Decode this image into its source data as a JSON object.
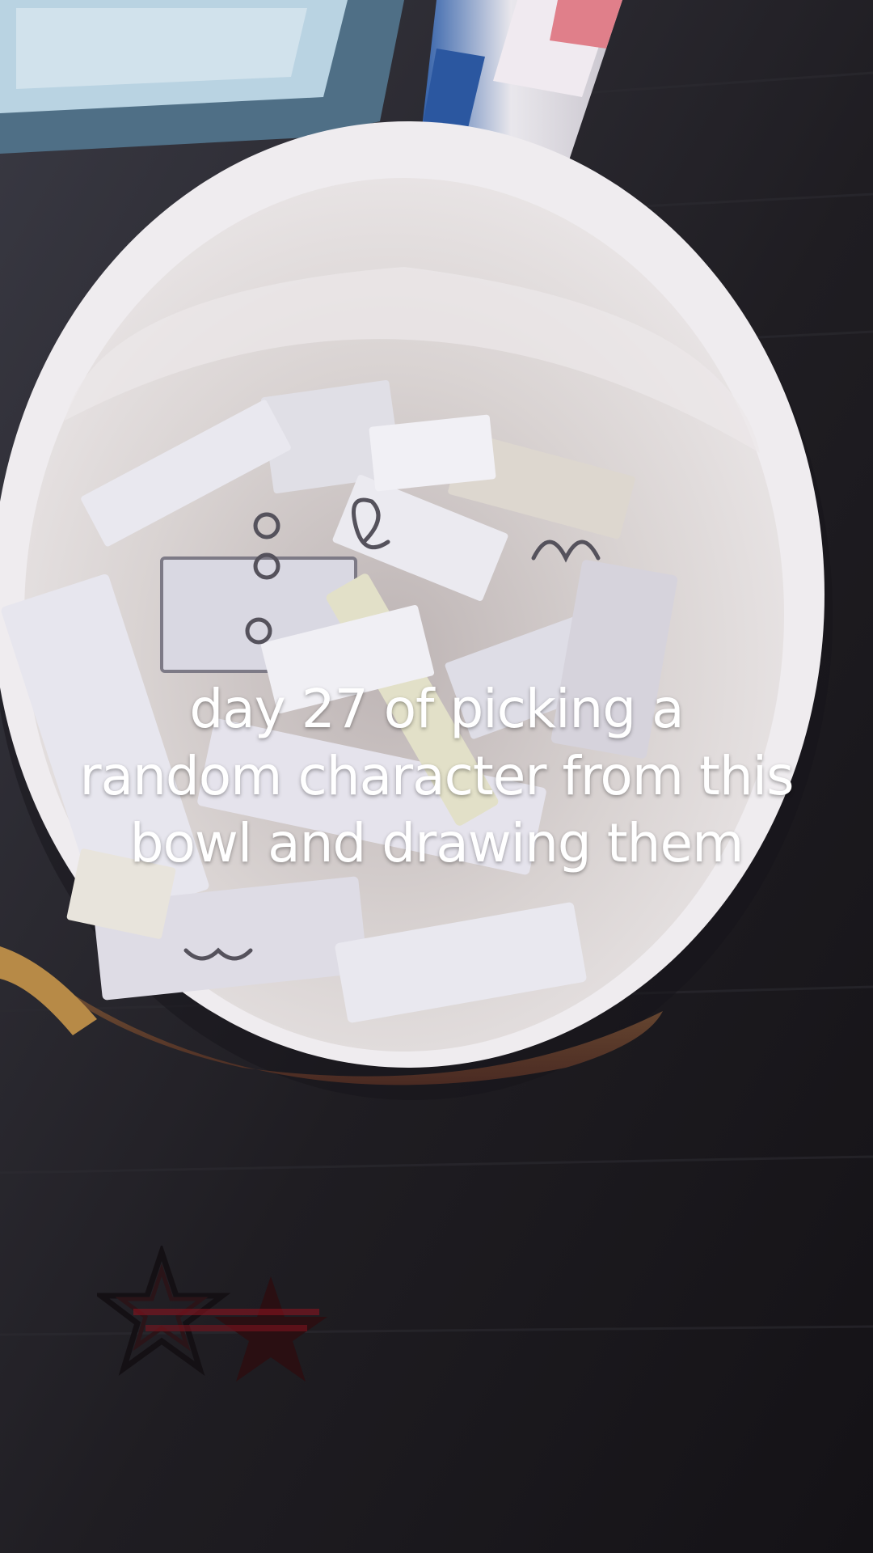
{
  "caption": {
    "lines": [
      "day 27 of picking a",
      "random character from this",
      "bowl and drawing them"
    ]
  },
  "watermark": {
    "shapes": [
      "star-icon",
      "star-icon"
    ]
  },
  "colors": {
    "table": "#1c1a1d",
    "bowl_rim": "#eeecef",
    "bowl_inside": "#ddd7d6",
    "paper": "#e6e5ec",
    "caption_text": "#ffffff",
    "star_dark": "#2a0f12",
    "star_accent": "#8a1420"
  }
}
